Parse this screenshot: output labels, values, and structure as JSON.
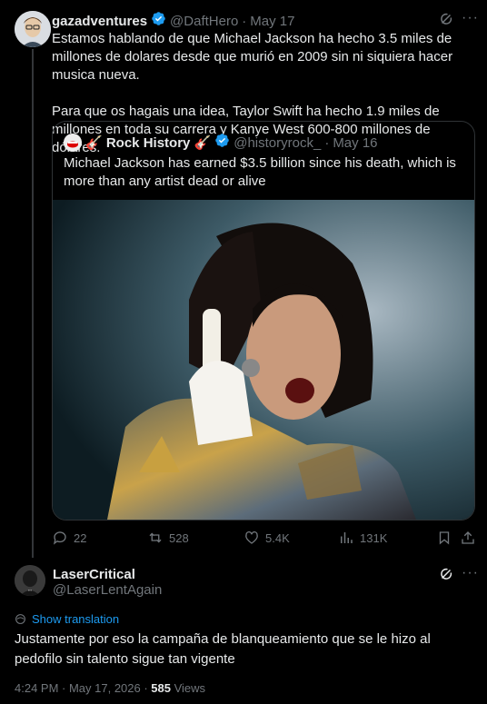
{
  "tweet": {
    "author_name": "gazadventures",
    "author_handle": "@DaftHero",
    "date": "May 17",
    "text_p1": "Estamos hablando de que Michael Jackson ha hecho 3.5 miles de millones de dolares desde que murió en 2009 sin ni siquiera hacer musica nueva.",
    "text_p2": "Para que os hagais una idea, Taylor Swift ha hecho 1.9 miles de millones en toda su carrera y Kanye West 600-800 millones de dólares.",
    "stats": {
      "replies": "22",
      "reposts": "528",
      "likes": "5.4K",
      "views": "131K"
    }
  },
  "quote": {
    "author_name": "🎸 Rock History 🎸",
    "author_handle": "@historyrock_",
    "date": "May 16",
    "text": "Michael Jackson has earned $3.5 billion since his death, which is more than any artist dead or alive"
  },
  "reply": {
    "author_name": "LaserCritical",
    "author_handle": "@LaserLentAgain",
    "show_translation": "Show translation",
    "text": "Justamente por eso la campaña de blanqueamiento que se le hizo al pedofilo sin talento sigue tan vigente",
    "timestamp": "4:24 PM · May 17, 2026 · ",
    "views_count": "585",
    "views_label": " Views"
  },
  "colors": {
    "accent": "#1d9bf0",
    "background": "#000000",
    "muted": "#71767b"
  },
  "icons": [
    "grok-icon",
    "more-icon",
    "verified-icon",
    "reply-icon",
    "repost-icon",
    "like-icon",
    "views-icon",
    "bookmark-icon",
    "share-icon",
    "translate-icon"
  ]
}
